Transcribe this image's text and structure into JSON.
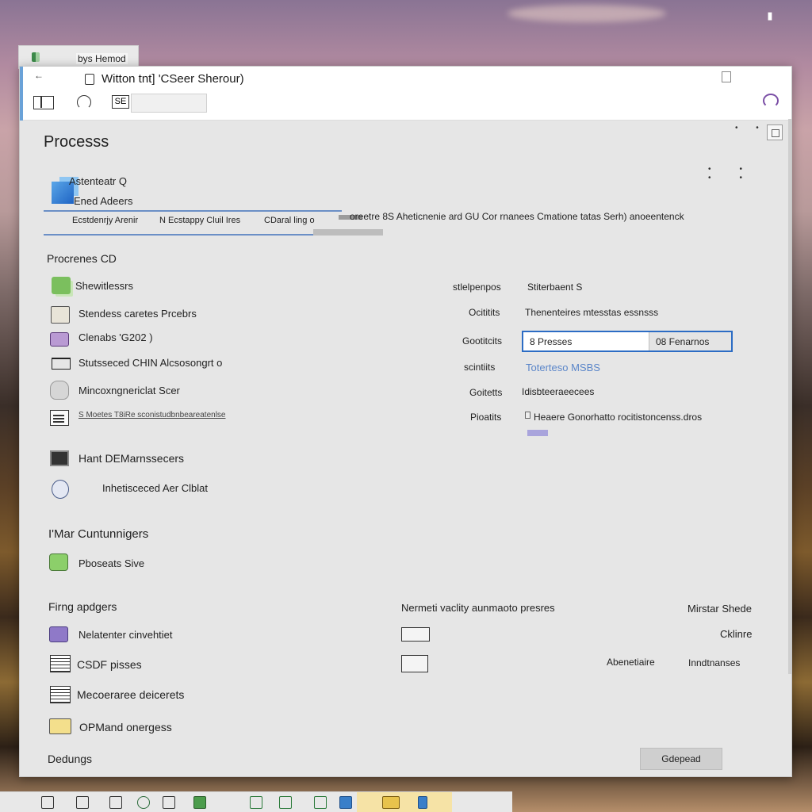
{
  "back_tab": {
    "label": "bys Hemod"
  },
  "window": {
    "back_symbol": "←",
    "title": "Witton tnt] 'CSeer Sherour)",
    "tool3_label": "SE",
    "page_title": "Processs"
  },
  "tile": {
    "label1": "Astenteatr Q",
    "label2": "Ened Adeers"
  },
  "tabs": [
    {
      "label": "Ecstdenrjy Arenir"
    },
    {
      "label": "N Ecstappy Cluil Ires"
    },
    {
      "label": "CDaral ling o"
    }
  ],
  "tabs_desc": "oreetre 8S Aheticnenie ard GU Cor rnanees Cmatione tatas Serh) anoeentenck",
  "section_processes": {
    "heading": "Procrenes CD",
    "rows": [
      {
        "label": "Shewitlessrs",
        "mid": "stlelpenpos",
        "right": "Stiterbaent S",
        "icon": "green-app-icon"
      },
      {
        "label": "Stendess caretes Prcebrs",
        "mid": "Ocititits",
        "right": "Thenenteires mtesstas essnsss",
        "icon": "disk-icon"
      },
      {
        "label": "Clenabs  'G202 )",
        "mid": "Gootitcits",
        "right": "",
        "icon": "chip-icon"
      },
      {
        "label": "Stutsseced CHIN Alcsosongrt o",
        "mid": "scintiits",
        "right": "Toterteso MSBS",
        "icon": "monitor-icon"
      },
      {
        "label": "Mincoxngnericlat Scer",
        "mid": "Goitetts",
        "right": "Idisbteeraeecees",
        "icon": "bag-icon"
      },
      {
        "label": "S Moetes T8iRe sconistudbnbeareatenlse",
        "mid": "Pioatits",
        "right": "Heaere Gonorhatto rocitistoncenss.dros",
        "icon": "document-icon"
      }
    ],
    "combo_left": "8 Presses",
    "combo_right": "08 Fenarnos"
  },
  "section_extra": {
    "rows": [
      {
        "label": "Hant DEMarnssecers",
        "icon": "black-square-icon"
      },
      {
        "label": "Inhetisceced Aer Clblat",
        "icon": "network-icon"
      }
    ]
  },
  "section_computers": {
    "heading": "I'Mar Cuntunnigers",
    "rows": [
      {
        "label": "Pboseats Sive",
        "icon": "green-box-icon"
      }
    ]
  },
  "section_programs": {
    "heading": "Firng apdgers",
    "rows": [
      {
        "label": "Nelatenter cinvehtiet",
        "icon": "purple-box-icon"
      },
      {
        "label": "CSDF pisses",
        "icon": "lines-icon"
      },
      {
        "label": "Mecoeraree deicerets",
        "icon": "lines-icon"
      },
      {
        "label": "OPMand onergess",
        "icon": "folder-icon"
      }
    ],
    "mid_heading": "Nermeti vaclity aunmaoto presres",
    "right_heading": "Mirstar Shede",
    "row1_right": "Cklinre",
    "row2_mid": "Abenetiaire",
    "row2_right": "Inndtnanses"
  },
  "footer": {
    "label": "Dedungs",
    "ok_label": "Gdepead"
  }
}
